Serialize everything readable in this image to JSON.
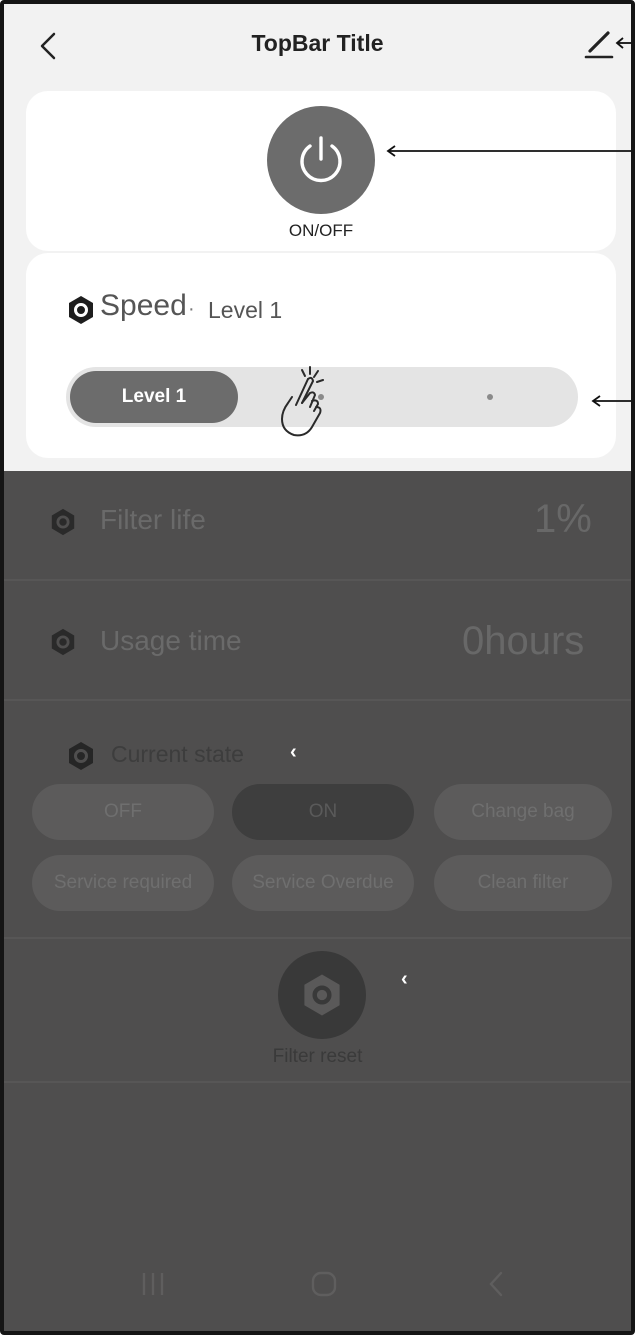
{
  "topbar": {
    "title": "TopBar Title",
    "back_icon": "chevron-left-icon",
    "edit_icon": "pencil-icon"
  },
  "power": {
    "label": "ON/OFF",
    "icon": "power-icon"
  },
  "speed": {
    "title": "Speed",
    "separator": "·",
    "current_level": "Level 1",
    "slider_label": "Level 1",
    "level_count": 3,
    "selected_index": 0
  },
  "filter_life": {
    "label": "Filter life",
    "value": "1%"
  },
  "usage_time": {
    "label": "Usage time",
    "value": "0hours"
  },
  "current_state": {
    "title": "Current state",
    "options": [
      "OFF",
      "ON",
      "Change bag",
      "Service required",
      "Service Overdue",
      "Clean filter"
    ],
    "active": "ON"
  },
  "filter_reset": {
    "label": "Filter reset"
  },
  "colors": {
    "accent": "#6c6c6c",
    "overlay": "#4f4e4e",
    "card": "#ffffff"
  }
}
